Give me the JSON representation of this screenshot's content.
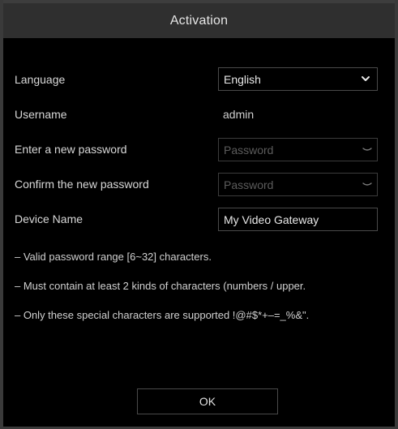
{
  "dialog": {
    "title": "Activation"
  },
  "form": {
    "language": {
      "label": "Language",
      "selected": "English"
    },
    "username": {
      "label": "Username",
      "value": "admin"
    },
    "new_password": {
      "label": "Enter a new password",
      "placeholder": "Password"
    },
    "confirm_password": {
      "label": "Confirm the new password",
      "placeholder": "Password"
    },
    "device_name": {
      "label": "Device Name",
      "value": "My Video Gateway"
    }
  },
  "notes": [
    "– Valid password range [6~32] characters.",
    "– Must contain at least 2 kinds of characters (numbers / upper.",
    "– Only these special characters are supported !@#$*+–=_%&\"."
  ],
  "actions": {
    "ok_label": "OK"
  },
  "icons": {
    "dropdown": "chevron-down-icon",
    "password_visibility": "eye-closed-icon"
  }
}
